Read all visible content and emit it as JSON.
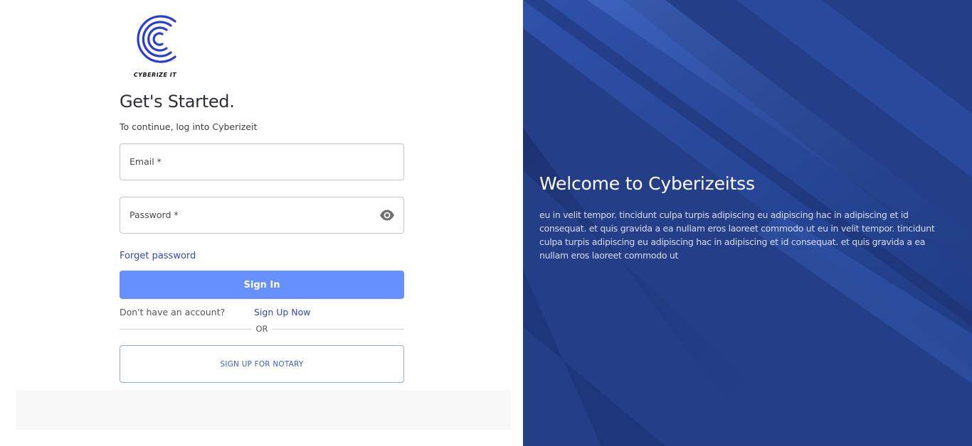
{
  "brand": {
    "logo_text": "CYBERIZE IT",
    "logo_color": "#2b3dd6"
  },
  "login": {
    "title": "Get's Started.",
    "subtitle": "To continue, log into Cyberizeit",
    "email_label": "Email *",
    "password_label": "Password *",
    "password_toggle_icon": "eye-icon",
    "forgot_password": "Forget password",
    "sign_in_label": "Sign In",
    "no_account_text": "Don't have an account?",
    "sign_up_link": "Sign Up Now",
    "divider_text": "OR",
    "notary_button": "SIGN UP FOR NOTARY"
  },
  "welcome": {
    "title": "Welcome to Cyberizeitss",
    "body": "eu in velit tempor. tincidunt culpa turpis adipiscing eu adipiscing hac in adipiscing et id consequat. et quis gravida a ea nullam eros laoreet commodo ut eu in velit tempor. tincidunt culpa turpis adipiscing eu adipiscing hac in adipiscing et id consequat. et quis gravida a ea nullam eros laoreet commodo ut"
  },
  "colors": {
    "primary_button": "#6690fe",
    "link": "#3346b3",
    "panel_background": "#233f86"
  }
}
